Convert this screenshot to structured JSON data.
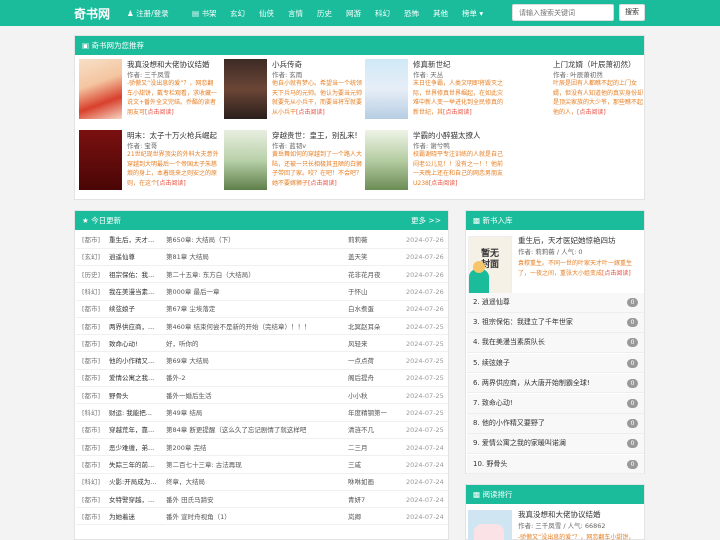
{
  "nav": {
    "logo": "奇书网",
    "user_label": "注册/登录",
    "categories": [
      "书架",
      "玄幻",
      "仙侠",
      "言情",
      "历史",
      "网游",
      "科幻",
      "恐怖",
      "其他",
      "榜单"
    ],
    "search_placeholder": "请输入搜索关键词",
    "search_button": "搜索"
  },
  "recommend": {
    "title": "奇书网为您推荐",
    "items": [
      {
        "title": "我真没想和大佬协议结婚",
        "author": "作者: 三千凤雪",
        "desc": "-骄傲又“没出息的爱”？，网恋翻车小甜饼，戴专栏观看，求收藏一说文+番外全文完结。乔酷的读者朋友可",
        "link": "[点击阅读]",
        "cover": "cover-red"
      },
      {
        "title": "小兵传奇",
        "author": "作者: 玄雨",
        "desc": "他自小就有梦心。希望当一个统领天下兵马的元帅。他认为要当元帅就要先从小兵干，而要当将军就要从小兵干",
        "link": "[点击阅读]",
        "cover": "cover-dark"
      },
      {
        "title": "修真新世纪",
        "author": "作者: 天丛",
        "desc": "末日往争霸，人类文明即将毁灭之际，世界修真世界崛起，在如此灾难中新人变一举进化到全民修真的新世纪，其",
        "link": "[点击阅读]",
        "cover": "cover-city"
      },
      {
        "title": "上门龙婿（叶辰萧初然）",
        "author": "作者: 叶辰萧初然",
        "desc": "叶辰是因有人都瞧不起的上门女婿，但没有人知道他的真实身份却是顶尖家族的大少爷，那些瞧不起他的人，",
        "link": "[点击阅读]",
        "cover": "cover-none"
      },
      {
        "title": "明末：太子十万火枪兵崛起",
        "author": "作者: 宝哥",
        "desc": "21世纪现世界顶尖的外科大夫意外穿越到大明最后一个帝国太子朱慈烺的身上，本着既来之则安之的原则，在这个",
        "link": "[点击阅读]",
        "cover": "cover-maroon"
      },
      {
        "title": "穿越贵世：皇王，别乱来!",
        "author": "作者: 蓝韧v",
        "desc": "黄岳舞如何的穿越到了一个路人大陆，还被一只长相极其丑陋的白狮子带回了家。咬？在吧！不会吧？她不要嫁狮子",
        "link": "[点击阅读]",
        "cover": "cover-green"
      },
      {
        "title": "学霸的小醉猫太撩人",
        "author": "作者: 谢兮鸭",
        "desc": "校霸谢晓平专注训练的人就是自己闷老公儿见！！没有之一！！他前一天晚上还在和自己的网恋男朋友U238",
        "link": "[点击阅读]",
        "cover": "cover-green2"
      }
    ]
  },
  "today": {
    "title": "今日更新",
    "more": "更多 >>",
    "rows": [
      {
        "cat": "[都市]",
        "name": "重生后，天才...",
        "chapter": "第650章: 大结局（下）",
        "author": "莉莉薇",
        "date": "2024-07-26"
      },
      {
        "cat": "[玄幻]",
        "name": "逍遥仙尊",
        "chapter": "第81章 大结局",
        "author": "盖天笑",
        "date": "2024-07-26"
      },
      {
        "cat": "[历史]",
        "name": "祖宗保佑：我...",
        "chapter": "第二十五章: 东方白（大结局）",
        "author": "花非花月夜",
        "date": "2024-07-26"
      },
      {
        "cat": "[科幻]",
        "name": "我在美漫当素...",
        "chapter": "第000章 最后一章",
        "author": "于怀山",
        "date": "2024-07-26"
      },
      {
        "cat": "[都市]",
        "name": "续弦娘子",
        "chapter": "第67章 尘埃落定",
        "author": "白水煮蛋",
        "date": "2024-07-26"
      },
      {
        "cat": "[都市]",
        "name": "两界供应商，...",
        "chapter": "第460章 结束何尝不是新的开始（完结章）！！！",
        "author": "北冥赵耳朵",
        "date": "2024-07-25"
      },
      {
        "cat": "[都市]",
        "name": "致命心动!",
        "chapter": "好，听你的",
        "author": "风轻来",
        "date": "2024-07-25"
      },
      {
        "cat": "[都市]",
        "name": "他的小作精又...",
        "chapter": "第69章 大结局",
        "author": "一点点荷",
        "date": "2024-07-25"
      },
      {
        "cat": "[都市]",
        "name": "爱情公寓之我...",
        "chapter": "番外-2",
        "author": "阁后提舟",
        "date": "2024-07-25"
      },
      {
        "cat": "[都市]",
        "name": "野骨头",
        "chapter": "番外一婚后生活",
        "author": "小小秋",
        "date": "2024-07-25"
      },
      {
        "cat": "[科幻]",
        "name": "财运: 我能把...",
        "chapter": "第49章 结局",
        "author": "年度精钢第一",
        "date": "2024-07-25"
      },
      {
        "cat": "[都市]",
        "name": "穿越荒年，靠...",
        "chapter": "第84章 断更提醒（这么久了忘记剧情了就这样吧sorry安",
        "author": "清涟不几",
        "date": "2024-07-25"
      },
      {
        "cat": "[都市]",
        "name": "恶少难缠，弟...",
        "chapter": "第200章 完结",
        "author": "二三月",
        "date": "2024-07-24"
      },
      {
        "cat": "[都市]",
        "name": "失踪三年的前...",
        "chapter": "第二百七十三章: 古法再现",
        "author": "三咸",
        "date": "2024-07-24"
      },
      {
        "cat": "[科幻]",
        "name": "火影:开局成为...",
        "chapter": "终章，大结局",
        "author": "咻咻如画",
        "date": "2024-07-24"
      },
      {
        "cat": "[都市]",
        "name": "女特警穿越，...",
        "chapter": "番外 田氏马蹄安",
        "author": "青妍7",
        "date": "2024-07-24"
      },
      {
        "cat": "[都市]",
        "name": "为她着迷",
        "chapter": "番外 宣时舟视角（1）",
        "author": "岚卿",
        "date": "2024-07-24"
      }
    ]
  },
  "newbooks": {
    "title": "新书入库",
    "top": {
      "title": "重生后，天才医妃她惊艳四坊",
      "meta": "作者: 莉莉薇 / 人气: 0",
      "desc": "袁穆重生。不同一世的叶家天才叶一嫁重生了，一夜之间，重张大小姐变成",
      "link": "[点击阅读]",
      "cover_text": "暂无封面"
    },
    "items": [
      {
        "label": "2. 逍遥仙尊",
        "count": "0"
      },
      {
        "label": "3. 祖宗保佑：我建立了千年世家",
        "count": "0"
      },
      {
        "label": "4. 我在美漫当素质队长",
        "count": "0"
      },
      {
        "label": "5. 续弦娘子",
        "count": "0"
      },
      {
        "label": "6. 两界供应商，从大唐开始制霸全球!",
        "count": "0"
      },
      {
        "label": "7. 致命心动!",
        "count": "0"
      },
      {
        "label": "8. 他的小作精又要野了",
        "count": "0"
      },
      {
        "label": "9. 爱情公寓之我的家暖叫诺澜",
        "count": "0"
      },
      {
        "label": "10. 野骨头",
        "count": "0"
      }
    ]
  },
  "ranking": {
    "title": "阅读排行",
    "top": {
      "title": "我真没想和大佬协议结婚",
      "meta": "作者: 三千凤雪 / 人气: 66862",
      "desc": "-骄傲又“没出息的爱”？，网恋翻车小甜饼，"
    }
  },
  "colors": {
    "accent": "#1abc9c",
    "orange": "#e67e22",
    "red": "#e74c3c"
  }
}
